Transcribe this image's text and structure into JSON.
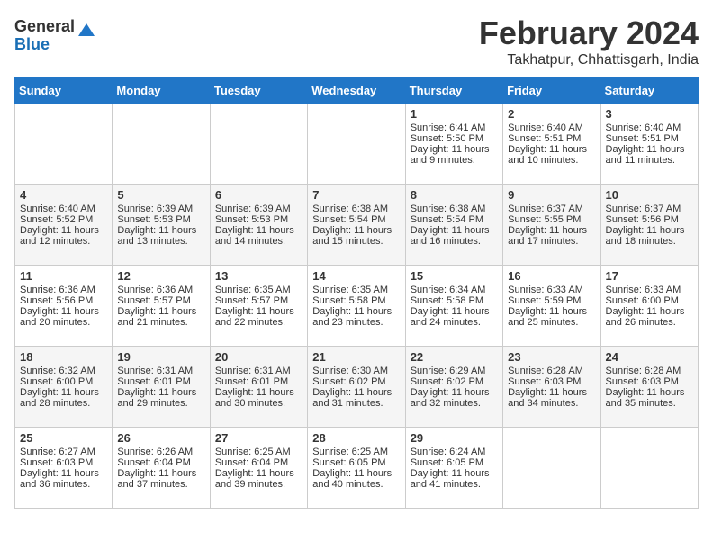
{
  "header": {
    "logo_general": "General",
    "logo_blue": "Blue",
    "month_title": "February 2024",
    "location": "Takhatpur, Chhattisgarh, India"
  },
  "days_of_week": [
    "Sunday",
    "Monday",
    "Tuesday",
    "Wednesday",
    "Thursday",
    "Friday",
    "Saturday"
  ],
  "weeks": [
    [
      {
        "day": "",
        "content": ""
      },
      {
        "day": "",
        "content": ""
      },
      {
        "day": "",
        "content": ""
      },
      {
        "day": "",
        "content": ""
      },
      {
        "day": "1",
        "content": "Sunrise: 6:41 AM\nSunset: 5:50 PM\nDaylight: 11 hours\nand 9 minutes."
      },
      {
        "day": "2",
        "content": "Sunrise: 6:40 AM\nSunset: 5:51 PM\nDaylight: 11 hours\nand 10 minutes."
      },
      {
        "day": "3",
        "content": "Sunrise: 6:40 AM\nSunset: 5:51 PM\nDaylight: 11 hours\nand 11 minutes."
      }
    ],
    [
      {
        "day": "4",
        "content": "Sunrise: 6:40 AM\nSunset: 5:52 PM\nDaylight: 11 hours\nand 12 minutes."
      },
      {
        "day": "5",
        "content": "Sunrise: 6:39 AM\nSunset: 5:53 PM\nDaylight: 11 hours\nand 13 minutes."
      },
      {
        "day": "6",
        "content": "Sunrise: 6:39 AM\nSunset: 5:53 PM\nDaylight: 11 hours\nand 14 minutes."
      },
      {
        "day": "7",
        "content": "Sunrise: 6:38 AM\nSunset: 5:54 PM\nDaylight: 11 hours\nand 15 minutes."
      },
      {
        "day": "8",
        "content": "Sunrise: 6:38 AM\nSunset: 5:54 PM\nDaylight: 11 hours\nand 16 minutes."
      },
      {
        "day": "9",
        "content": "Sunrise: 6:37 AM\nSunset: 5:55 PM\nDaylight: 11 hours\nand 17 minutes."
      },
      {
        "day": "10",
        "content": "Sunrise: 6:37 AM\nSunset: 5:56 PM\nDaylight: 11 hours\nand 18 minutes."
      }
    ],
    [
      {
        "day": "11",
        "content": "Sunrise: 6:36 AM\nSunset: 5:56 PM\nDaylight: 11 hours\nand 20 minutes."
      },
      {
        "day": "12",
        "content": "Sunrise: 6:36 AM\nSunset: 5:57 PM\nDaylight: 11 hours\nand 21 minutes."
      },
      {
        "day": "13",
        "content": "Sunrise: 6:35 AM\nSunset: 5:57 PM\nDaylight: 11 hours\nand 22 minutes."
      },
      {
        "day": "14",
        "content": "Sunrise: 6:35 AM\nSunset: 5:58 PM\nDaylight: 11 hours\nand 23 minutes."
      },
      {
        "day": "15",
        "content": "Sunrise: 6:34 AM\nSunset: 5:58 PM\nDaylight: 11 hours\nand 24 minutes."
      },
      {
        "day": "16",
        "content": "Sunrise: 6:33 AM\nSunset: 5:59 PM\nDaylight: 11 hours\nand 25 minutes."
      },
      {
        "day": "17",
        "content": "Sunrise: 6:33 AM\nSunset: 6:00 PM\nDaylight: 11 hours\nand 26 minutes."
      }
    ],
    [
      {
        "day": "18",
        "content": "Sunrise: 6:32 AM\nSunset: 6:00 PM\nDaylight: 11 hours\nand 28 minutes."
      },
      {
        "day": "19",
        "content": "Sunrise: 6:31 AM\nSunset: 6:01 PM\nDaylight: 11 hours\nand 29 minutes."
      },
      {
        "day": "20",
        "content": "Sunrise: 6:31 AM\nSunset: 6:01 PM\nDaylight: 11 hours\nand 30 minutes."
      },
      {
        "day": "21",
        "content": "Sunrise: 6:30 AM\nSunset: 6:02 PM\nDaylight: 11 hours\nand 31 minutes."
      },
      {
        "day": "22",
        "content": "Sunrise: 6:29 AM\nSunset: 6:02 PM\nDaylight: 11 hours\nand 32 minutes."
      },
      {
        "day": "23",
        "content": "Sunrise: 6:28 AM\nSunset: 6:03 PM\nDaylight: 11 hours\nand 34 minutes."
      },
      {
        "day": "24",
        "content": "Sunrise: 6:28 AM\nSunset: 6:03 PM\nDaylight: 11 hours\nand 35 minutes."
      }
    ],
    [
      {
        "day": "25",
        "content": "Sunrise: 6:27 AM\nSunset: 6:03 PM\nDaylight: 11 hours\nand 36 minutes."
      },
      {
        "day": "26",
        "content": "Sunrise: 6:26 AM\nSunset: 6:04 PM\nDaylight: 11 hours\nand 37 minutes."
      },
      {
        "day": "27",
        "content": "Sunrise: 6:25 AM\nSunset: 6:04 PM\nDaylight: 11 hours\nand 39 minutes."
      },
      {
        "day": "28",
        "content": "Sunrise: 6:25 AM\nSunset: 6:05 PM\nDaylight: 11 hours\nand 40 minutes."
      },
      {
        "day": "29",
        "content": "Sunrise: 6:24 AM\nSunset: 6:05 PM\nDaylight: 11 hours\nand 41 minutes."
      },
      {
        "day": "",
        "content": ""
      },
      {
        "day": "",
        "content": ""
      }
    ]
  ]
}
